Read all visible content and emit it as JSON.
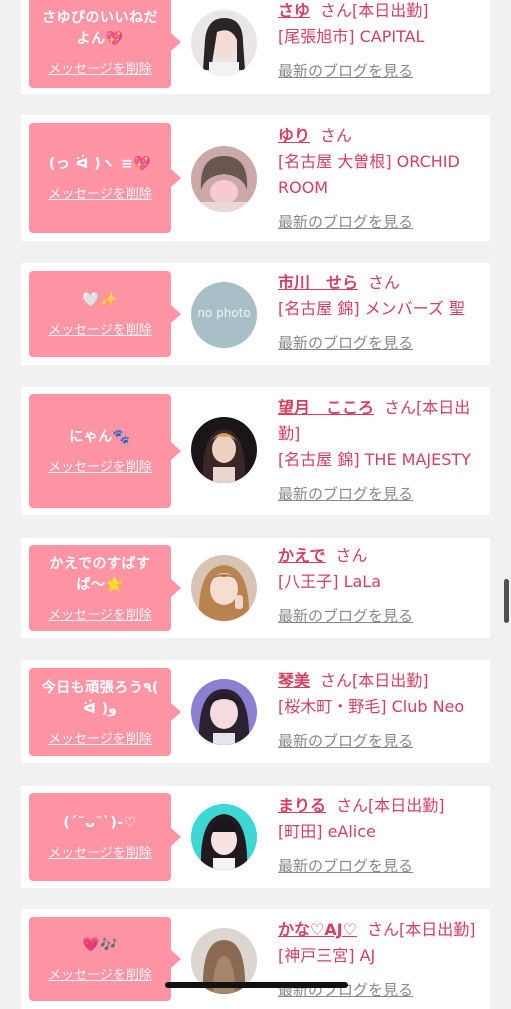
{
  "delete_label": "メッセージを削除",
  "blog_label": "最新のブログを見る",
  "san": "さん",
  "colors": {
    "bubble": "#ff94a4",
    "name": "#d6405f",
    "link_gray": "#888888"
  },
  "entries": [
    {
      "message": "さゆぴのいいねだよん💖",
      "name": "さゆ",
      "status": "[本日出勤]",
      "shop": "[尾張旭市] CAPITAL",
      "avatar": "photo"
    },
    {
      "message": "(っ ᐛ )ヽ ≡💖",
      "name": "ゆり",
      "status": "",
      "shop": "[名古屋 大曽根] ORCHID ROOM",
      "avatar": "photo"
    },
    {
      "message": "🤍✨",
      "name": "市川　せら",
      "status": "",
      "shop": "[名古屋 錦] メンバーズ 聖",
      "avatar": "no photo"
    },
    {
      "message": "にゃん🐾",
      "name": "望月　こころ",
      "status": "[本日出勤]",
      "shop": "[名古屋 錦] THE MAJESTY",
      "avatar": "photo"
    },
    {
      "message": "かえでのすばすば〜🌟",
      "name": "かえで",
      "status": "",
      "shop": "[八王子] LaLa",
      "avatar": "photo"
    },
    {
      "message": "今日も頑張ろう٩( ᐛ )و",
      "name": "琴美",
      "status": "[本日出勤]",
      "shop": "[桜木町・野毛] Club Neo",
      "avatar": "photo"
    },
    {
      "message": "(ˊ˘ᴗ˘ˋ)-♡",
      "name": "まりる",
      "status": "[本日出勤]",
      "shop": "[町田] eAlice",
      "avatar": "photo"
    },
    {
      "message": "💗🎶",
      "name": "かな♡AJ♡",
      "status": "[本日出勤]",
      "shop": "[神戸三宮] AJ",
      "avatar": "photo"
    }
  ]
}
